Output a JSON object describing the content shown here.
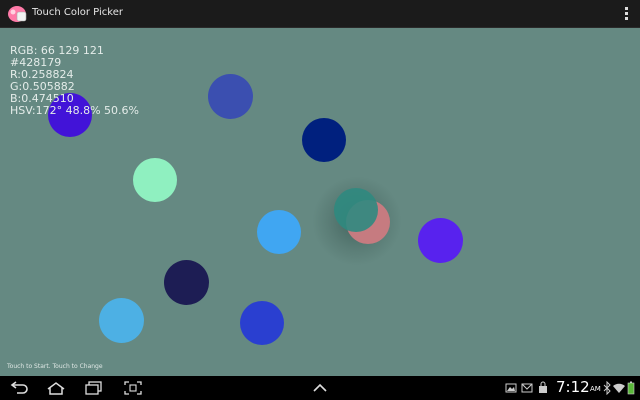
{
  "app": {
    "title": "Touch Color Picker"
  },
  "readout": {
    "rgb": "RGB: 66 129 121",
    "hex": "#428179",
    "r": "R:0.258824",
    "g": "G:0.505882",
    "b": "B:0.474510",
    "hsv": "HSV:172° 48.8% 50.6%"
  },
  "hint": "Touch to Start. Touch to Change",
  "colors": {
    "canvas_background": "#658982",
    "selected": "#428179",
    "circles": [
      "#4213d8",
      "#3b4fb0",
      "#00207e",
      "#8ff0c0",
      "#40a6f2",
      "#2f8a80",
      "#c67b80",
      "#5822ee",
      "#1d1d54",
      "#4db0e4",
      "#2a3fd0"
    ]
  },
  "status": {
    "time": "7:12",
    "ampm": "AM"
  },
  "icons": [
    "app-palette-icon",
    "overflow-menu-icon",
    "back-icon",
    "home-icon",
    "recent-apps-icon",
    "screenshot-icon",
    "up-chevron-icon",
    "gallery-icon",
    "email-icon",
    "store-icon",
    "bluetooth-icon",
    "wifi-icon",
    "battery-icon"
  ]
}
